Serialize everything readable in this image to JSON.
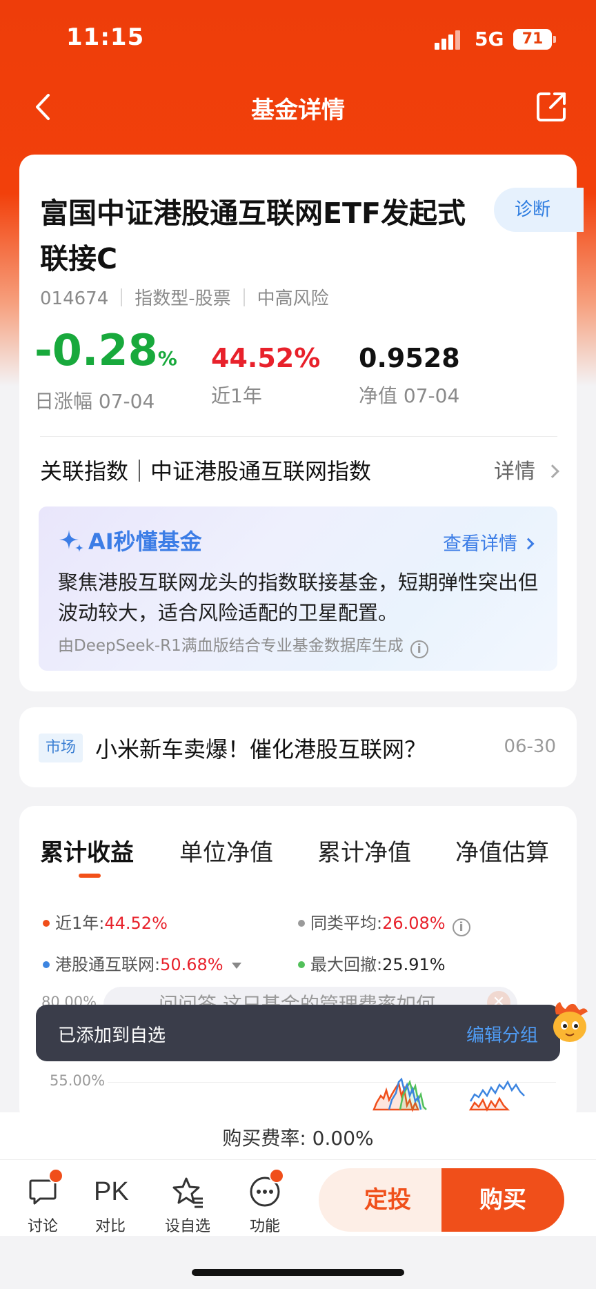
{
  "status": {
    "time": "11:15",
    "network": "5G",
    "battery": "71"
  },
  "nav": {
    "title": "基金详情"
  },
  "fund": {
    "name": "富国中证港股通互联网ETF发起式联接C",
    "code": "014674",
    "type": "指数型-股票",
    "risk": "中高风险",
    "diagnose_label": "诊断",
    "daily_change": {
      "value": "-0.28",
      "unit": "%",
      "label": "日涨幅 07-04"
    },
    "year_return": {
      "value": "44.52%",
      "label": "近1年"
    },
    "nav": {
      "value": "0.9528",
      "label": "净值 07-04"
    },
    "related_index": "关联指数｜中证港股通互联网指数",
    "related_detail": "详情"
  },
  "ai": {
    "title": "AI秒懂基金",
    "more": "查看详情",
    "text": "聚焦港股互联网龙头的指数联接基金，短期弹性突出但波动较大，适合风险适配的卫星配置。",
    "source": "由DeepSeek-R1满血版结合专业基金数据库生成"
  },
  "news": {
    "tag": "市场",
    "title": "小米新车卖爆！催化港股互联网？",
    "date": "06-30"
  },
  "chart": {
    "tabs": [
      "累计收益",
      "单位净值",
      "累计净值",
      "净值估算"
    ],
    "legend": [
      {
        "label": "近1年:",
        "value": "44.52%",
        "color": "#f04e1a"
      },
      {
        "label": "同类平均:",
        "value": "26.08%",
        "color": "#9a9a9a"
      },
      {
        "label": "港股通互联网:",
        "value": "50.68%",
        "color": "#3d85e0"
      },
      {
        "label": "最大回撤:",
        "value": "25.91%",
        "color": "#52c05a"
      }
    ],
    "y_ticks": [
      "80.00%",
      "55.00%"
    ],
    "ghost_question": "问问答 这只基金的管理费率如何"
  },
  "chart_data": {
    "type": "line",
    "title": "",
    "xlabel": "",
    "ylabel": "",
    "ylim": [
      55,
      80
    ],
    "series": [
      {
        "name": "近1年",
        "values": [
          44.52
        ]
      },
      {
        "name": "同类平均",
        "values": [
          26.08
        ]
      },
      {
        "name": "港股通互联网",
        "values": [
          50.68
        ]
      }
    ]
  },
  "toast": {
    "text": "已添加到自选",
    "action": "编辑分组"
  },
  "fee": {
    "text": "购买费率: 0.00%"
  },
  "bottom": {
    "discuss": "讨论",
    "pk_icon": "PK",
    "compare": "对比",
    "watch": "设自选",
    "features": "功能",
    "sip_button": "定投",
    "buy_button": "购买"
  }
}
